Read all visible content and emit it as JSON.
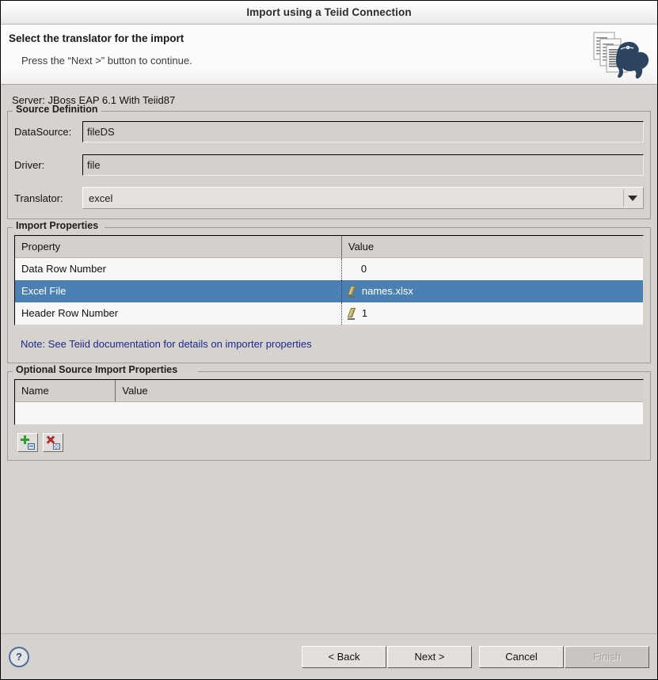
{
  "window": {
    "title": "Import using a Teiid Connection"
  },
  "banner": {
    "title": "Select the translator for the import",
    "subtitle": "Press the “Next >” button to continue.",
    "logo_icon": "teiid-documents-dinosaur-logo"
  },
  "server_line": "Server: JBoss EAP 6.1 With Teiid87",
  "source_definition": {
    "legend": "Source Definition",
    "fields": [
      {
        "label": "DataSource:",
        "value": "fileDS",
        "type": "readonly-text"
      },
      {
        "label": "Driver:",
        "value": "file",
        "type": "readonly-text"
      },
      {
        "label": "Translator:",
        "value": "excel",
        "type": "combo"
      }
    ]
  },
  "import_properties": {
    "legend": "Import Properties",
    "columns": [
      "Property",
      "Value"
    ],
    "rows": [
      {
        "property": "Data Row Number",
        "value": "0",
        "icon": "",
        "selected": false
      },
      {
        "property": "Excel File",
        "value": "names.xlsx",
        "icon": "pencil-icon",
        "selected": true
      },
      {
        "property": "Header Row Number",
        "value": "1",
        "icon": "pencil-icon",
        "selected": false
      }
    ],
    "note": "Note: See Teiid documentation for details on importer properties",
    "note_color": "#1b2a8c",
    "selection_color": "#4a80b4"
  },
  "optional_properties": {
    "legend": "Optional Source Import Properties",
    "columns": [
      "Name",
      "Value"
    ],
    "rows": [],
    "toolbar": [
      {
        "name": "add-property-button",
        "icon": "add-icon",
        "tooltip": "Add"
      },
      {
        "name": "remove-property-button",
        "icon": "remove-icon",
        "tooltip": "Remove"
      }
    ]
  },
  "footer": {
    "help_icon": "help-question-icon",
    "buttons": [
      {
        "label": "< Back",
        "name": "back-button",
        "disabled": false
      },
      {
        "label": "Next >",
        "name": "next-button",
        "disabled": false
      },
      {
        "label": "Cancel",
        "name": "cancel-button",
        "disabled": false
      },
      {
        "label": "Finish",
        "name": "finish-button",
        "disabled": true
      }
    ]
  }
}
